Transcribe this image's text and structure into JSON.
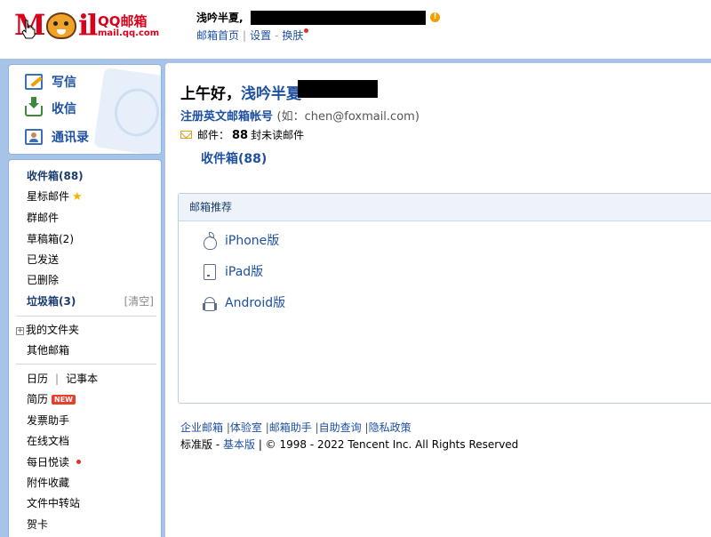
{
  "header": {
    "logo_text_m": "M",
    "logo_text_il": "il",
    "logo_qq": "QQ邮箱",
    "logo_url": "mail.qq.com",
    "user_name": "浅吟半夏,",
    "links": [
      "邮箱首页",
      "设置",
      "换肤"
    ],
    "link_sep": "|",
    "link_dash": "-"
  },
  "nav": {
    "compose": "写信",
    "receive": "收信",
    "contacts": "通讯录"
  },
  "folders": {
    "inbox": "收件箱(88)",
    "starred": "星标邮件",
    "group": "群邮件",
    "drafts": "草稿箱(2)",
    "sent": "已发送",
    "deleted": "已删除",
    "junk": "垃圾箱(3)",
    "junk_clear": "[清空]",
    "my_folders": "我的文件夹",
    "other_mailboxes": "其他邮箱",
    "calendar": "日历",
    "notebook": "记事本",
    "calendar_sep": "|",
    "resume": "简历",
    "new_badge": "NEW",
    "invoice": "发票助手",
    "online_docs": "在线文档",
    "daily_reading": "每日悦读",
    "attachments": "附件收藏",
    "file_transfer": "文件中转站",
    "cards": "贺卡"
  },
  "main": {
    "greeting": "上午好，",
    "nickname": "浅吟半夏",
    "register_text": "注册英文邮箱帐号",
    "register_example": "(如：chen@foxmail.com)",
    "mail_label": "邮件：",
    "mail_count": "88",
    "mail_suffix": "封未读邮件",
    "inbox_link": "收件箱(88)",
    "recommend_title": "邮箱推荐",
    "recommend_items": [
      "iPhone版",
      "iPad版",
      "Android版"
    ],
    "footer_links": [
      "企业邮箱",
      "体验室",
      "邮箱助手",
      "自助查询",
      "隐私政策"
    ],
    "footer_sep": "|",
    "copyright_std": "标准版",
    "copyright_dash": " - ",
    "copyright_basic": "基本版",
    "copyright_rest": " | © 1998 - 2022 Tencent Inc. All Rights Reserved"
  },
  "colors": {
    "accent": "#1e50a2",
    "frame": "#a7c4e8",
    "brand": "#d9001b"
  }
}
